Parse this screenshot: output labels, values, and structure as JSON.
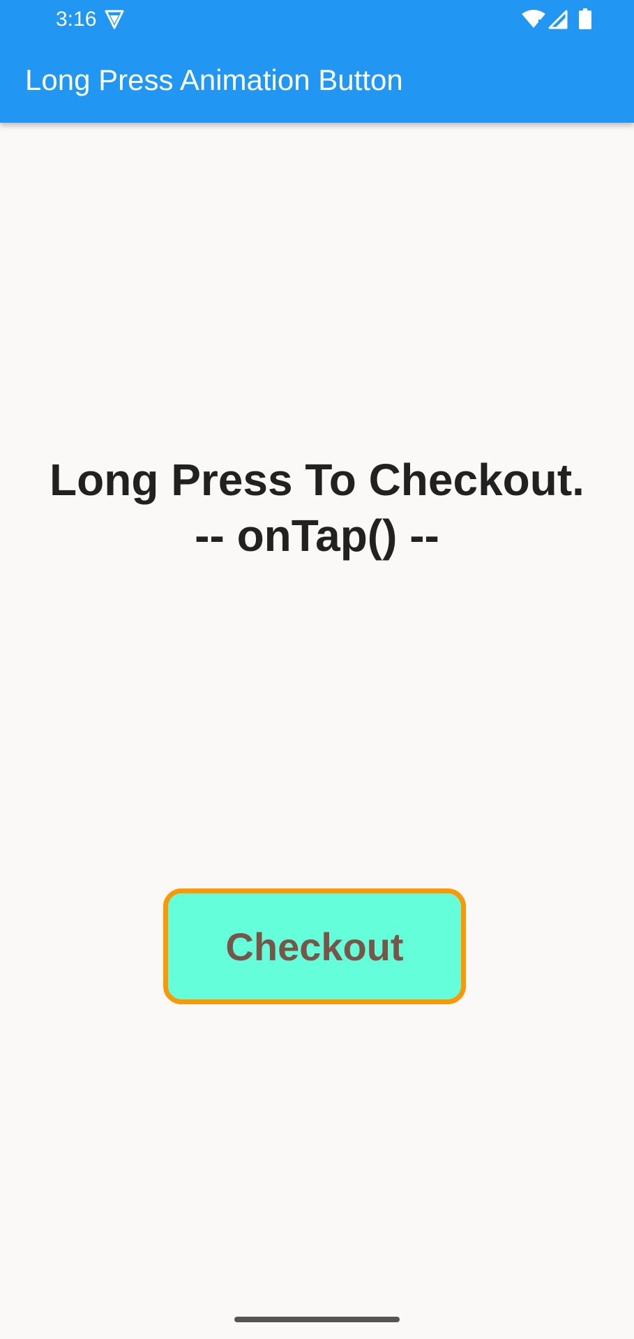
{
  "status_bar": {
    "time": "3:16",
    "icons": [
      "vpn-shield-icon",
      "wifi-icon",
      "cell-signal-icon",
      "battery-icon"
    ]
  },
  "app_bar": {
    "title": "Long Press Animation Button",
    "color": "#2196f3"
  },
  "main": {
    "message_line1": "Long Press To Checkout.",
    "message_line2": "-- onTap() --"
  },
  "checkout_button": {
    "label": "Checkout",
    "fill_color": "#64ffda",
    "border_color": "#ff9800",
    "text_color": "#795548"
  }
}
